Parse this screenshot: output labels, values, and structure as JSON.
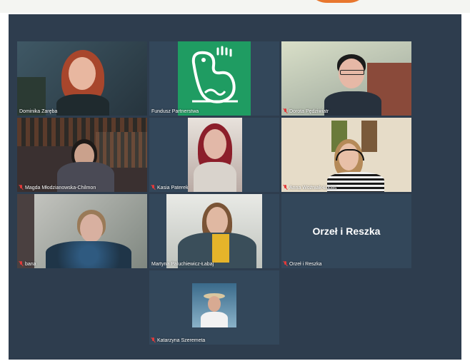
{
  "participants": [
    {
      "name": "Dominika Zaręba",
      "muted": false
    },
    {
      "name": "Fundusz Partnerstwa",
      "muted": false
    },
    {
      "name": "Dorota Pędziwiatr",
      "muted": true
    },
    {
      "name": "Magda Młodzianowska-Chilmon",
      "muted": true
    },
    {
      "name": "Kasia Paterek",
      "muted": true
    },
    {
      "name": "Anna Woźniak-Łubas",
      "muted": true
    },
    {
      "name": "bana",
      "muted": true
    },
    {
      "name": "Martyna Paluchiewicz-Łabaj",
      "muted": false
    },
    {
      "name": "Orzeł i Reszka",
      "muted": true
    },
    {
      "name": "Katarzyna Szeremeta",
      "muted": true
    }
  ],
  "orzel_tile_label": "Orzeł i Reszka",
  "colors": {
    "stage": "#2e3d4e",
    "tile": "#33475a",
    "active_border": "#d8e24a",
    "logo_green": "#1f9c62",
    "mute_red": "#e33a3a"
  },
  "icons": [
    "muted-mic-icon",
    "fundusz-bird-logo-icon"
  ]
}
